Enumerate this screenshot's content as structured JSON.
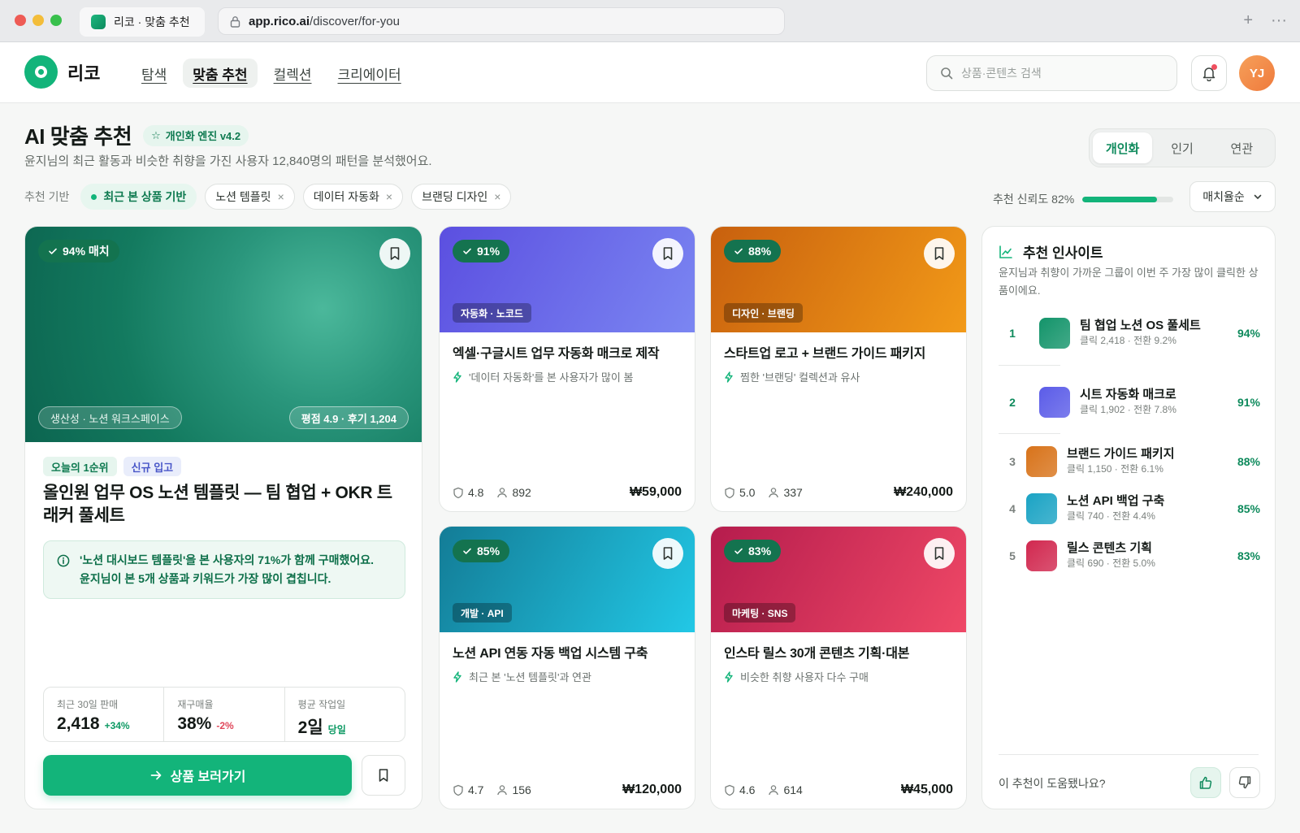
{
  "browser": {
    "tab_title": "리코 · 맞춤 추천",
    "url_host": "app.rico.ai",
    "url_path": "/discover/for-you",
    "new_tab": "+",
    "menu": "···"
  },
  "header": {
    "logo": "리코",
    "nav": [
      "탐색",
      "맞춤 추천",
      "컬렉션",
      "크리에이터"
    ],
    "search_placeholder": "상품·콘텐츠 검색",
    "avatar": "YJ"
  },
  "page": {
    "title": "AI 맞춤 추천",
    "engine_badge": "개인화 엔진 v4.2",
    "subtitle": "윤지님의 최근 활동과 비슷한 취향을 가진 사용자 12,840명의 패턴을 분석했어요.",
    "segments": [
      "개인화",
      "인기",
      "연관"
    ]
  },
  "filters": {
    "label": "추천 기반",
    "primary": "최근 본 상품 기반",
    "chips": [
      "노션 템플릿",
      "데이터 자동화",
      "브랜딩 디자인"
    ],
    "remove_glyph": "×",
    "confidence_label": "추천 신뢰도 82%",
    "confidence_value": 0.82,
    "sort": "매치율순"
  },
  "featured": {
    "match": "94% 매치",
    "category": "생산성 · 노션 워크스페이스",
    "rating": "평점 4.9 · 후기 1,204",
    "tags": [
      "오늘의 1순위",
      "신규 입고"
    ],
    "title": "올인원 업무 OS 노션 템플릿 — 팀 협업 + OKR 트래커 풀세트",
    "insight_line1": "'노션 대시보드 템플릿'을 본 사용자의 71%가 함께 구매했어요.",
    "insight_line2": "윤지님이 본 5개 상품과 키워드가 가장 많이 겹칩니다.",
    "stats": [
      {
        "label": "최근 30일 판매",
        "value": "2,418",
        "delta": "+34%"
      },
      {
        "label": "재구매율",
        "value": "38%",
        "delta": "-2%"
      },
      {
        "label": "평균 작업일",
        "value": "2일",
        "delta": "당일"
      }
    ],
    "cta": "상품 보러가기",
    "hero_colors": [
      "#4bb89b",
      "#0c6550"
    ]
  },
  "products": [
    {
      "match": "91%",
      "category": "자동화 · 노코드",
      "title": "엑셀·구글시트 업무 자동화 매크로 제작",
      "reason": "'데이터 자동화'를 본 사용자가 많이 봄",
      "rating": "4.8",
      "buyers": "892",
      "price": "₩59,000",
      "colors": [
        "#5b4fe0",
        "#7b86f2"
      ]
    },
    {
      "match": "88%",
      "category": "디자인 · 브랜딩",
      "title": "스타트업 로고 + 브랜드 가이드 패키지",
      "reason": "찜한 '브랜딩' 컬렉션과 유사",
      "rating": "5.0",
      "buyers": "337",
      "price": "₩240,000",
      "colors": [
        "#c8600e",
        "#f29a18"
      ]
    },
    {
      "match": "85%",
      "category": "개발 · API",
      "title": "노션 API 연동 자동 백업 시스템 구축",
      "reason": "최근 본 '노션 템플릿'과 연관",
      "rating": "4.7",
      "buyers": "156",
      "price": "₩120,000",
      "colors": [
        "#137c96",
        "#22c8e6"
      ]
    },
    {
      "match": "83%",
      "category": "마케팅 · SNS",
      "title": "인스타 릴스 30개 콘텐츠 기획·대본",
      "reason": "비슷한 취향 사용자 다수 구매",
      "rating": "4.6",
      "buyers": "614",
      "price": "₩45,000",
      "colors": [
        "#b51c4d",
        "#ef4866"
      ]
    }
  ],
  "insights": {
    "title": "추천 인사이트",
    "description": "윤지님과 취향이 가까운 그룹이 이번 주 가장 많이 클릭한 상품이에요.",
    "items": [
      {
        "rank": "1",
        "name": "팀 협업 노션 OS 풀세트",
        "meta": "클릭 2,418 · 전환 9.2%",
        "pct": "94%",
        "color": "#13946a"
      },
      {
        "rank": "2",
        "name": "시트 자동화 매크로",
        "meta": "클릭 1,902 · 전환 7.8%",
        "pct": "91%",
        "color": "#5b5ce8"
      },
      {
        "rank": "3",
        "name": "브랜드 가이드 패키지",
        "meta": "클릭 1,150 · 전환 6.1%",
        "pct": "88%",
        "color": "#d8731a"
      },
      {
        "rank": "4",
        "name": "노션 API 백업 구축",
        "meta": "클릭 740 · 전환 4.4%",
        "pct": "85%",
        "color": "#1aa3c4"
      },
      {
        "rank": "5",
        "name": "릴스 콘텐츠 기획",
        "meta": "클릭 690 · 전환 5.0%",
        "pct": "83%",
        "color": "#d1284f"
      }
    ],
    "feedback_question": "이 추천이 도움됐나요?"
  }
}
